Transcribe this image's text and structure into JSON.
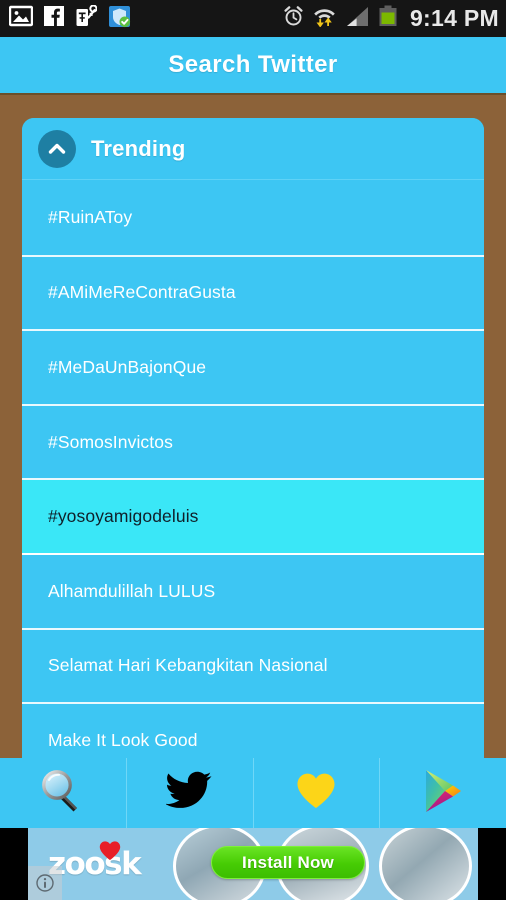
{
  "statusbar": {
    "time": "9:14 PM",
    "left_icons": [
      "gallery-image-icon",
      "facebook-icon",
      "key-tag-icon",
      "security-shield-icon"
    ],
    "right_icons": [
      "alarm-clock-icon",
      "wifi-data-transfer-icon",
      "cellular-signal-icon",
      "battery-icon"
    ],
    "background_color": "#151515"
  },
  "titlebar": {
    "title": "Search Twitter",
    "background_color": "#3dc6f3"
  },
  "page": {
    "background_color": "#8c6239",
    "accent_color": "#3dc6f3",
    "selected_color": "#3ae7f7"
  },
  "card": {
    "header": {
      "title": "Trending",
      "collapse_icon": "chevron-up-icon",
      "icon_background": "#1e7fa3"
    },
    "items": [
      {
        "label": "#RuinAToy",
        "selected": false
      },
      {
        "label": "#AMiMeReContraGusta",
        "selected": false
      },
      {
        "label": "#MeDaUnBajonQue",
        "selected": false
      },
      {
        "label": "#SomosInvictos",
        "selected": false
      },
      {
        "label": "#yosoyamigodeluis",
        "selected": true
      },
      {
        "label": "Alhamdulillah LULUS",
        "selected": false
      },
      {
        "label": "Selamat Hari Kebangkitan Nasional",
        "selected": false
      },
      {
        "label": "Make It Look Good",
        "selected": false
      }
    ]
  },
  "tabbar": {
    "tabs": [
      {
        "name": "search",
        "icon": "magnifying-glass-icon"
      },
      {
        "name": "twitter",
        "icon": "twitter-bird-icon"
      },
      {
        "name": "favorites",
        "icon": "yellow-heart-icon"
      },
      {
        "name": "play-store",
        "icon": "google-play-icon"
      }
    ],
    "background_color": "#3dc6f3"
  },
  "ad": {
    "brand": "zoosk",
    "brand_heart_icon": "red-heart-icon",
    "cta_label": "Install Now",
    "cta_color": "#46cc04",
    "info_icon": "ad-info-icon",
    "background_color": "#8ecbe8"
  }
}
